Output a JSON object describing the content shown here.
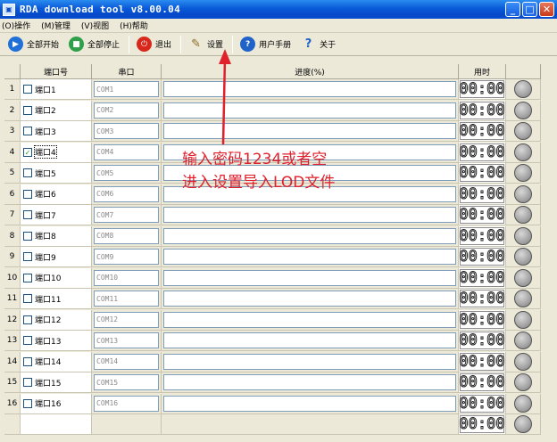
{
  "window": {
    "title": "RDA download tool v8.00.04"
  },
  "menu": [
    {
      "label": "(O)操作"
    },
    {
      "label": "(M)管理"
    },
    {
      "label": "(V)视图"
    },
    {
      "label": "(H)帮助"
    }
  ],
  "toolbar": {
    "start_all": "全部开始",
    "stop_all": "全部停止",
    "exit": "退出",
    "settings": "设置",
    "manual": "用户手册",
    "about": "关于"
  },
  "table": {
    "headers": {
      "port": "端口号",
      "com": "串口",
      "progress": "进度(%)",
      "time": "用时"
    },
    "time_default": "00:00",
    "rows": [
      {
        "num": "1",
        "port": "端口1",
        "com": "COM1",
        "checked": false
      },
      {
        "num": "2",
        "port": "端口2",
        "com": "COM2",
        "checked": false
      },
      {
        "num": "3",
        "port": "端口3",
        "com": "COM3",
        "checked": false
      },
      {
        "num": "4",
        "port": "端口4",
        "com": "COM4",
        "checked": true
      },
      {
        "num": "5",
        "port": "端口5",
        "com": "COM5",
        "checked": false
      },
      {
        "num": "6",
        "port": "端口6",
        "com": "COM6",
        "checked": false
      },
      {
        "num": "7",
        "port": "端口7",
        "com": "COM7",
        "checked": false
      },
      {
        "num": "8",
        "port": "端口8",
        "com": "COM8",
        "checked": false
      },
      {
        "num": "9",
        "port": "端口9",
        "com": "COM9",
        "checked": false
      },
      {
        "num": "10",
        "port": "端口10",
        "com": "COM10",
        "checked": false
      },
      {
        "num": "11",
        "port": "端口11",
        "com": "COM11",
        "checked": false
      },
      {
        "num": "12",
        "port": "端口12",
        "com": "COM12",
        "checked": false
      },
      {
        "num": "13",
        "port": "端口13",
        "com": "COM13",
        "checked": false
      },
      {
        "num": "14",
        "port": "端口14",
        "com": "COM14",
        "checked": false
      },
      {
        "num": "15",
        "port": "端口15",
        "com": "COM15",
        "checked": false
      },
      {
        "num": "16",
        "port": "端口16",
        "com": "COM16",
        "checked": false
      }
    ],
    "extra_rows": 1
  },
  "annotation": {
    "line1": "输入密码1234或者空",
    "line2": "进入设置导入LOD文件",
    "color": "#e0202c"
  }
}
